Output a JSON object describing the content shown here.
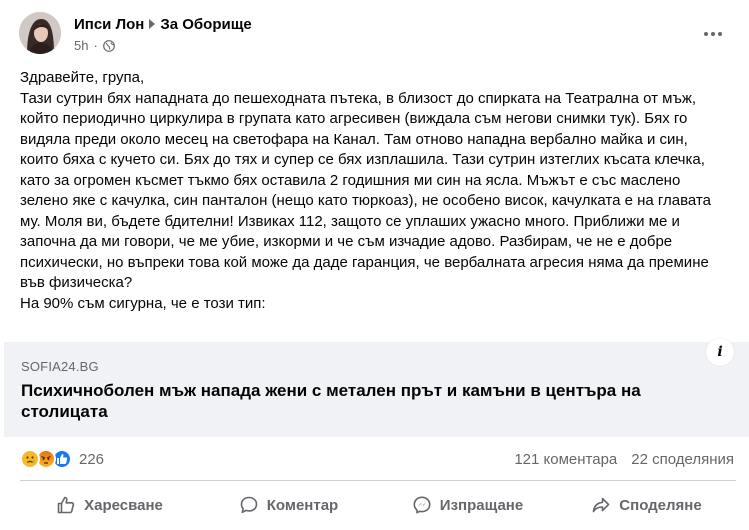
{
  "post": {
    "author": "Ипси Лон",
    "group": "За Оборище",
    "time": "5h",
    "privacy_icon": "globe-icon",
    "more_icon": "more-options-icon",
    "paragraphs": [
      "Здравейте, група,",
      "Тази сутрин бях нападната до пешеходната пътека, в близост до спирката на Театрална от мъж, който периодично циркулира в групата като агресивен (виждала съм негови снимки тук). Бях го видяла преди около месец на светофара на Канал. Там отново нападна вербално майка и син, които бяха с кучето си. Бях до тях и супер се бях изплашила. Тази сутрин изтеглих късата клечка, като за огромен късмет тъкмо бях оставила 2 годишния ми син на ясла. Мъжът е със маслено зелено яке с качулка, син панталон (нещо като тюркоаз), не особено висок, качулката е на главата му. Моля ви, бъдете бдителни! Извиках 112, защото се уплаших ужасно много. Приближи ме и започна да ми говори, че ме убие, изкорми и че съм изчадие адово. Разбирам, че не е добре психически, но въпреки това кой може да даде гаранция, че вербалната агресия няма да премине във физическа?",
      "На 90% съм сигурна, че е този тип:"
    ]
  },
  "link_preview": {
    "domain": "SOFIA24.BG",
    "title": "Психичноболен мъж напада жени с метален прът и камъни в центъра на столицата",
    "info_label": "i"
  },
  "stats": {
    "reaction_icons": [
      "sad-reaction-icon",
      "angry-reaction-icon",
      "like-reaction-icon"
    ],
    "reactions_count": "226",
    "comments": "121 коментара",
    "shares": "22 споделяния"
  },
  "actions": {
    "like": "Харесване",
    "comment": "Коментар",
    "send": "Изпращане",
    "share": "Споделяне"
  },
  "colors": {
    "secondary_text": "#65676b",
    "card_bg": "#f0f2f5",
    "like_blue": "#1877f2",
    "reaction_yellow": "#f7b928",
    "divider": "#ced0d4"
  }
}
